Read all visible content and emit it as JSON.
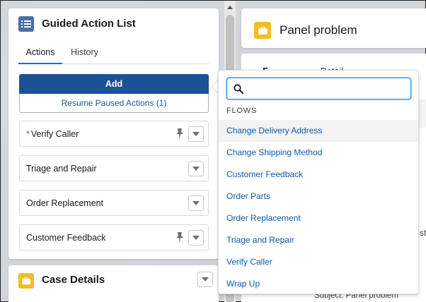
{
  "guided_action_list": {
    "title": "Guided Action List",
    "icon": "list-icon",
    "tabs": [
      {
        "label": "Actions",
        "active": true
      },
      {
        "label": "History",
        "active": false
      }
    ],
    "add_label": "Add",
    "resume_label": "Resume Paused Actions (1)",
    "actions": [
      {
        "label": "Verify Caller",
        "required": true,
        "pinned": true
      },
      {
        "label": "Triage and Repair",
        "required": false,
        "pinned": false
      },
      {
        "label": "Order Replacement",
        "required": false,
        "pinned": false
      },
      {
        "label": "Customer Feedback",
        "required": false,
        "pinned": true
      }
    ],
    "required_marker": "*"
  },
  "case_details": {
    "title": "Case Details",
    "icon": "briefcase-icon"
  },
  "panel": {
    "title": "Panel problem",
    "icon": "briefcase-icon",
    "tab_peek_1": "F...",
    "tab_peek_2": "Detail",
    "right_peek": "st",
    "subject_text": "Subject: Panel problem"
  },
  "flow_picker": {
    "search_placeholder": "",
    "search_value": "",
    "group_label": "FLOWS",
    "items": [
      "Change Delivery Address",
      "Change Shipping Method",
      "Customer Feedback",
      "Order Parts",
      "Order Replacement",
      "Triage and Repair",
      "Verify Caller",
      "Wrap Up"
    ],
    "highlighted_index": 0
  },
  "colors": {
    "brand_blue": "#1b5297",
    "link_blue": "#0b5cab",
    "case_icon": "#f4bc25",
    "list_icon": "#4a6fa5",
    "required_red": "#c23934"
  }
}
